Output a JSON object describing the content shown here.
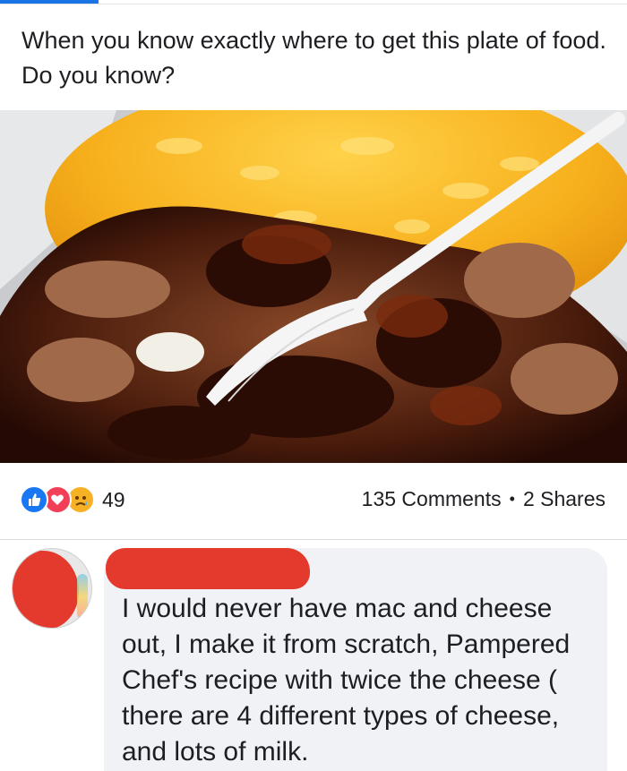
{
  "post": {
    "text": "When you know exactly where to get this plate of food. Do you know?"
  },
  "photo": {
    "description_icon": "food-photo"
  },
  "reactions": {
    "icons": [
      "like-icon",
      "love-icon",
      "sad-icon"
    ],
    "count": "49"
  },
  "engagement": {
    "comments": "135 Comments",
    "separator": "•",
    "shares": "2 Shares"
  },
  "comment": {
    "text": "I would never have mac and cheese out, I make it from scratch, Pampered Chef's recipe with twice the cheese ( there are 4 different types of cheese, and lots of milk."
  },
  "colors": {
    "accent": "#1877f2",
    "love": "#f33e58",
    "sad": "#f7b125",
    "redaction": "#e43a2d",
    "bubble": "#f0f2f5"
  }
}
